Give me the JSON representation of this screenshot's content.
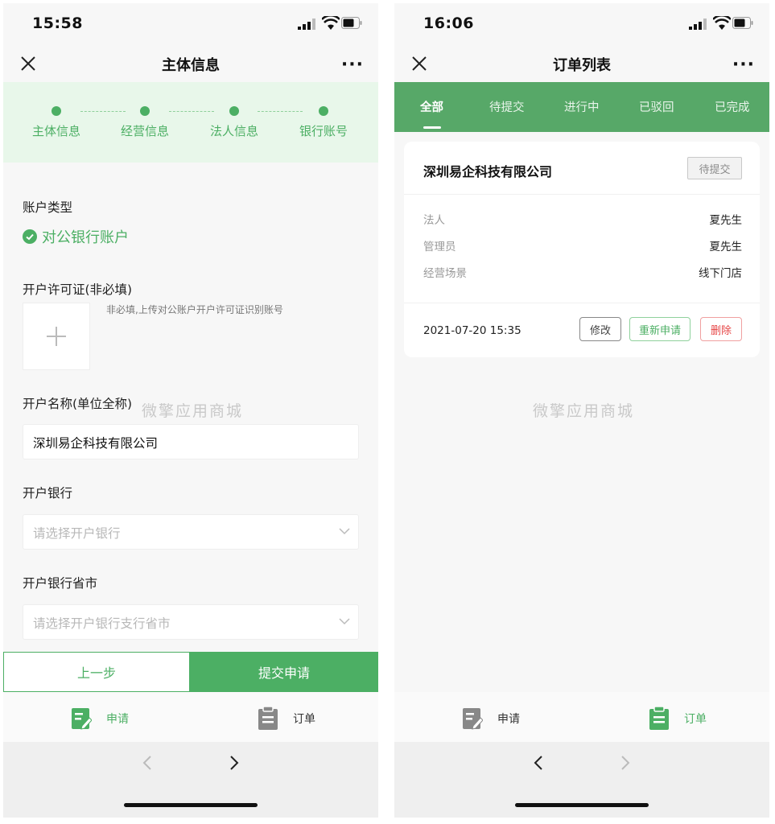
{
  "left": {
    "status": {
      "time": "15:58"
    },
    "nav": {
      "title": "主体信息",
      "more": "···"
    },
    "steps": [
      "主体信息",
      "经营信息",
      "法人信息",
      "银行账号"
    ],
    "form": {
      "account_type_label": "账户类型",
      "account_type_value": "对公银行账户",
      "permit_label": "开户许可证(非必填)",
      "permit_hint": "非必填,上传对公账户开户许可证识别账号",
      "name_label": "开户名称(单位全称)",
      "name_value": "深圳易企科技有限公司",
      "bank_label": "开户银行",
      "bank_placeholder": "请选择开户银行",
      "bank_city_label": "开户银行省市",
      "bank_city_placeholder": "请选择开户银行支行省市"
    },
    "watermark": "微擎应用商城",
    "buttons": {
      "prev": "上一步",
      "submit": "提交申请"
    },
    "tabbar": {
      "apply": "申请",
      "orders": "订单",
      "active": "apply"
    }
  },
  "right": {
    "status": {
      "time": "16:06"
    },
    "nav": {
      "title": "订单列表",
      "more": "···"
    },
    "filter_tabs": [
      "全部",
      "待提交",
      "进行中",
      "已驳回",
      "已完成"
    ],
    "active_tab": "全部",
    "order": {
      "company": "深圳易企科技有限公司",
      "status_badge": "待提交",
      "rows": [
        {
          "key": "法人",
          "value": "夏先生"
        },
        {
          "key": "管理员",
          "value": "夏先生"
        },
        {
          "key": "经营场景",
          "value": "线下门店"
        }
      ],
      "datetime": "2021-07-20 15:35",
      "actions": {
        "edit": "修改",
        "reapply": "重新申请",
        "delete": "删除"
      }
    },
    "watermark": "微擎应用商城",
    "tabbar": {
      "apply": "申请",
      "orders": "订单",
      "active": "orders"
    }
  },
  "colors": {
    "brand_green": "#4caf64",
    "tab_green": "#57a868",
    "step_bg": "#e8f7ea",
    "danger": "#e64545"
  }
}
